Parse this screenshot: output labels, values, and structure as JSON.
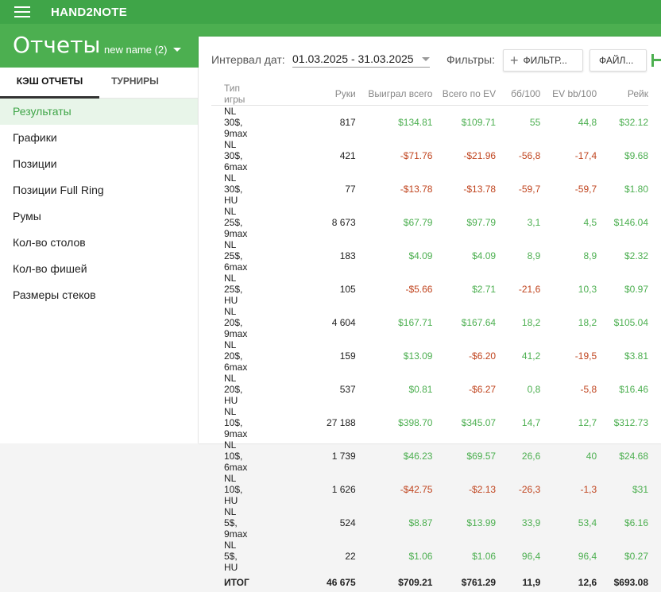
{
  "app": {
    "title": "HAND2NOTE"
  },
  "header": {
    "title": "Отчеты",
    "report_name": "new name (2)"
  },
  "sidebar": {
    "tabs": [
      {
        "label": "КЭШ ОТЧЕТЫ"
      },
      {
        "label": "ТУРНИРЫ"
      }
    ],
    "items": [
      {
        "label": "Результаты"
      },
      {
        "label": "Графики"
      },
      {
        "label": "Позиции"
      },
      {
        "label": "Позиции Full Ring"
      },
      {
        "label": "Румы"
      },
      {
        "label": "Кол-во столов"
      },
      {
        "label": "Кол-во фишей"
      },
      {
        "label": "Размеры стеков"
      }
    ]
  },
  "filters": {
    "date_label": "Интервал дат:",
    "date_range": "01.03.2025 - 31.03.2025",
    "filters_label": "Фильтры:",
    "filter_button": "ФИЛЬТР...",
    "files_button": "ФАЙЛ..."
  },
  "colors": {
    "header_green": "#3fa548",
    "positive": "#4caf50",
    "negative": "#c0441e"
  },
  "table": {
    "columns": [
      "Тип игры",
      "Руки",
      "Выиграл всего",
      "Всего по EV",
      "бб/100",
      "EV bb/100",
      "Рейк"
    ],
    "rows": [
      [
        "NL 30$, 9max",
        "817",
        "$134.81",
        "$109.71",
        "55",
        "44,8",
        "$32.12"
      ],
      [
        "NL 30$, 6max",
        "421",
        "-$71.76",
        "-$21.96",
        "-56,8",
        "-17,4",
        "$9.68"
      ],
      [
        "NL 30$, HU",
        "77",
        "-$13.78",
        "-$13.78",
        "-59,7",
        "-59,7",
        "$1.80"
      ],
      [
        "NL 25$, 9max",
        "8 673",
        "$67.79",
        "$97.79",
        "3,1",
        "4,5",
        "$146.04"
      ],
      [
        "NL 25$, 6max",
        "183",
        "$4.09",
        "$4.09",
        "8,9",
        "8,9",
        "$2.32"
      ],
      [
        "NL 25$, HU",
        "105",
        "-$5.66",
        "$2.71",
        "-21,6",
        "10,3",
        "$0.97"
      ],
      [
        "NL 20$, 9max",
        "4 604",
        "$167.71",
        "$167.64",
        "18,2",
        "18,2",
        "$105.04"
      ],
      [
        "NL 20$, 6max",
        "159",
        "$13.09",
        "-$6.20",
        "41,2",
        "-19,5",
        "$3.81"
      ],
      [
        "NL 20$, HU",
        "537",
        "$0.81",
        "-$6.27",
        "0,8",
        "-5,8",
        "$16.46"
      ],
      [
        "NL 10$, 9max",
        "27 188",
        "$398.70",
        "$345.07",
        "14,7",
        "12,7",
        "$312.73"
      ],
      [
        "NL 10$, 6max",
        "1 739",
        "$46.23",
        "$69.57",
        "26,6",
        "40",
        "$24.68"
      ],
      [
        "NL 10$, HU",
        "1 626",
        "-$42.75",
        "-$2.13",
        "-26,3",
        "-1,3",
        "$31"
      ],
      [
        "NL 5$, 9max",
        "524",
        "$8.87",
        "$13.99",
        "33,9",
        "53,4",
        "$6.16"
      ],
      [
        "NL 5$, HU",
        "22",
        "$1.06",
        "$1.06",
        "96,4",
        "96,4",
        "$0.27"
      ]
    ],
    "total": [
      "ИТОГ",
      "46 675",
      "$709.21",
      "$761.29",
      "11,9",
      "12,6",
      "$693.08"
    ]
  }
}
